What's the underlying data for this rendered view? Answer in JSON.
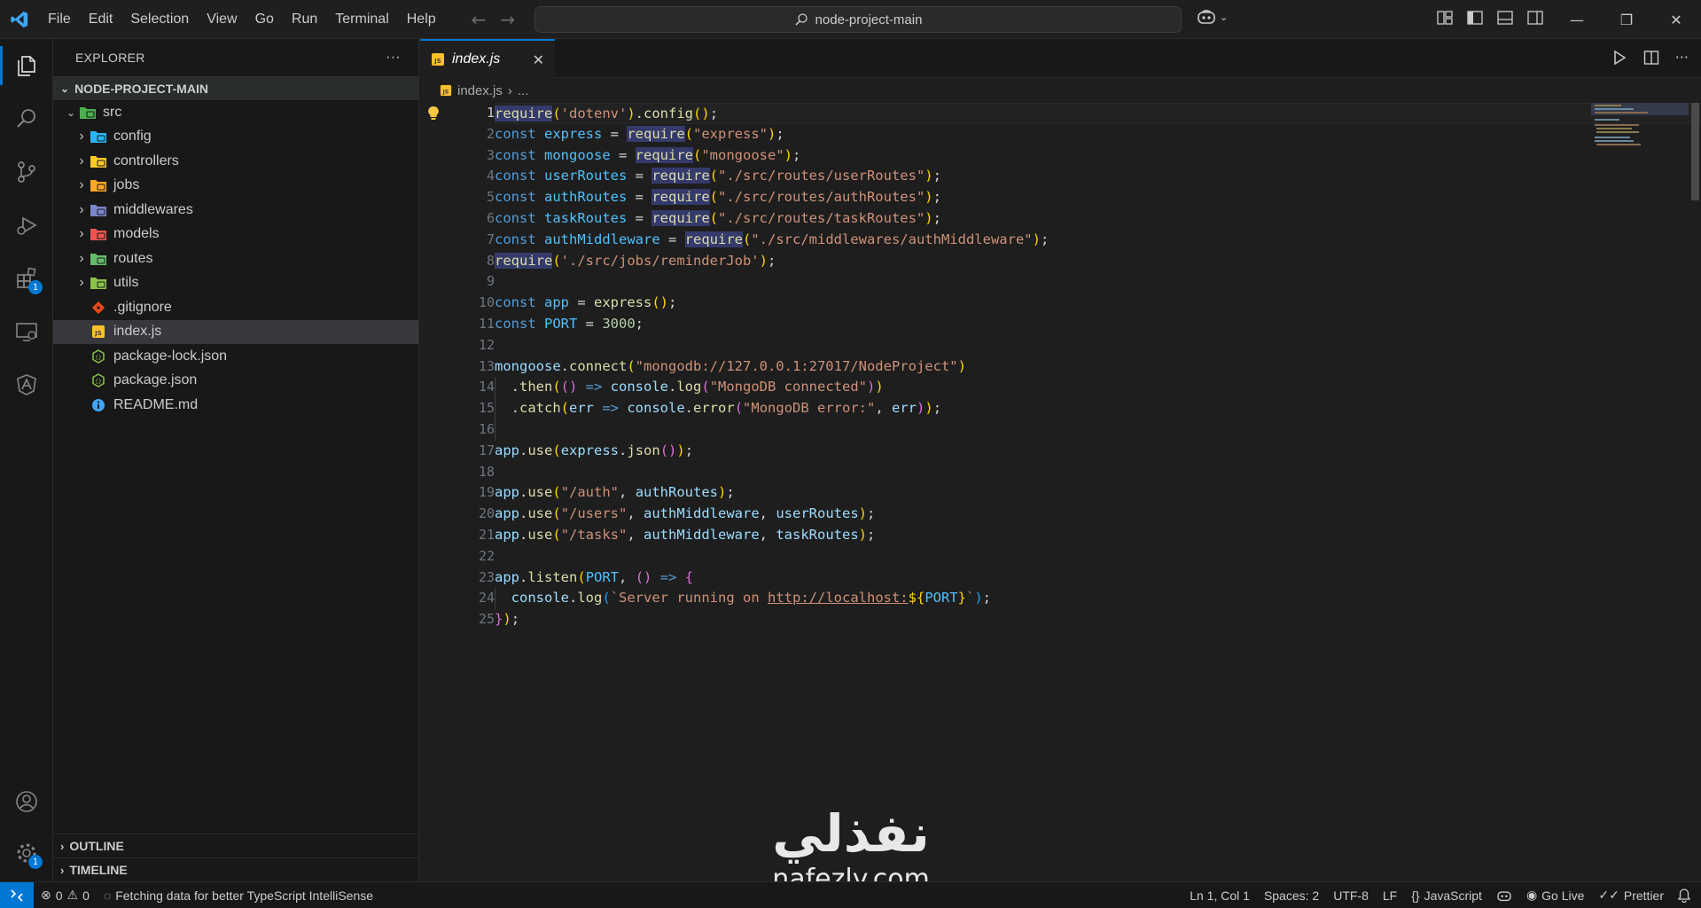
{
  "menu": [
    "File",
    "Edit",
    "Selection",
    "View",
    "Go",
    "Run",
    "Terminal",
    "Help"
  ],
  "command_center": "node-project-main",
  "explorer": {
    "title": "EXPLORER",
    "more": "···",
    "root": "NODE-PROJECT-MAIN",
    "items": [
      {
        "label": "src",
        "level": 1,
        "chevron": "⌄",
        "icon": "folder-src-icon",
        "color": "#4caf50"
      },
      {
        "label": "config",
        "level": 2,
        "chevron": "›",
        "icon": "folder-config-icon",
        "color": "#29b6f6"
      },
      {
        "label": "controllers",
        "level": 2,
        "chevron": "›",
        "icon": "folder-controllers-icon",
        "color": "#ffca28"
      },
      {
        "label": "jobs",
        "level": 2,
        "chevron": "›",
        "icon": "folder-jobs-icon",
        "color": "#ffa726"
      },
      {
        "label": "middlewares",
        "level": 2,
        "chevron": "›",
        "icon": "folder-middlewares-icon",
        "color": "#7986cb"
      },
      {
        "label": "models",
        "level": 2,
        "chevron": "›",
        "icon": "folder-models-icon",
        "color": "#ef5350"
      },
      {
        "label": "routes",
        "level": 2,
        "chevron": "›",
        "icon": "folder-routes-icon",
        "color": "#66bb6a"
      },
      {
        "label": "utils",
        "level": 2,
        "chevron": "›",
        "icon": "folder-utils-icon",
        "color": "#8bc34a"
      },
      {
        "label": ".gitignore",
        "level": 2,
        "chevron": "",
        "icon": "git-icon",
        "color": "#e64a19"
      },
      {
        "label": "index.js",
        "level": 2,
        "chevron": "",
        "icon": "js-file-icon",
        "color": "#fbc02d"
      },
      {
        "label": "package-lock.json",
        "level": 2,
        "chevron": "",
        "icon": "nodejs-icon",
        "color": "#8bc34a"
      },
      {
        "label": "package.json",
        "level": 2,
        "chevron": "",
        "icon": "nodejs-icon",
        "color": "#8bc34a"
      },
      {
        "label": "README.md",
        "level": 2,
        "chevron": "",
        "icon": "info-icon",
        "color": "#42a5f5"
      }
    ],
    "selected": "index.js",
    "outline": "OUTLINE",
    "timeline": "TIMELINE"
  },
  "activity": {
    "extensions_badge": "1",
    "settings_badge": "1"
  },
  "tab": {
    "label": "index.js",
    "close": "✕"
  },
  "breadcrumb": {
    "file": "index.js",
    "sep": "›",
    "rest": "..."
  },
  "code_lines": [
    [
      [
        "hl t-fn",
        "require"
      ],
      [
        "t-p1",
        "("
      ],
      [
        "t-str",
        "'dotenv'"
      ],
      [
        "t-p1",
        ")"
      ],
      [
        "t-pl",
        "."
      ],
      [
        "t-fn",
        "config"
      ],
      [
        "t-p1",
        "()"
      ],
      [
        "t-pl",
        ";"
      ]
    ],
    [
      [
        "t-kw",
        "const "
      ],
      [
        "t-const",
        "express"
      ],
      [
        "t-pl",
        " = "
      ],
      [
        "hl t-fn",
        "require"
      ],
      [
        "t-p1",
        "("
      ],
      [
        "t-str",
        "\"express\""
      ],
      [
        "t-p1",
        ")"
      ],
      [
        "t-pl",
        ";"
      ]
    ],
    [
      [
        "t-kw",
        "const "
      ],
      [
        "t-const",
        "mongoose"
      ],
      [
        "t-pl",
        " = "
      ],
      [
        "hl t-fn",
        "require"
      ],
      [
        "t-p1",
        "("
      ],
      [
        "t-str",
        "\"mongoose\""
      ],
      [
        "t-p1",
        ")"
      ],
      [
        "t-pl",
        ";"
      ]
    ],
    [
      [
        "t-kw",
        "const "
      ],
      [
        "t-const",
        "userRoutes"
      ],
      [
        "t-pl",
        " = "
      ],
      [
        "hl t-fn",
        "require"
      ],
      [
        "t-p1",
        "("
      ],
      [
        "t-str",
        "\"./src/routes/userRoutes\""
      ],
      [
        "t-p1",
        ")"
      ],
      [
        "t-pl",
        ";"
      ]
    ],
    [
      [
        "t-kw",
        "const "
      ],
      [
        "t-const",
        "authRoutes"
      ],
      [
        "t-pl",
        " = "
      ],
      [
        "hl t-fn",
        "require"
      ],
      [
        "t-p1",
        "("
      ],
      [
        "t-str",
        "\"./src/routes/authRoutes\""
      ],
      [
        "t-p1",
        ")"
      ],
      [
        "t-pl",
        ";"
      ]
    ],
    [
      [
        "t-kw",
        "const "
      ],
      [
        "t-const",
        "taskRoutes"
      ],
      [
        "t-pl",
        " = "
      ],
      [
        "hl t-fn",
        "require"
      ],
      [
        "t-p1",
        "("
      ],
      [
        "t-str",
        "\"./src/routes/taskRoutes\""
      ],
      [
        "t-p1",
        ")"
      ],
      [
        "t-pl",
        ";"
      ]
    ],
    [
      [
        "t-kw",
        "const "
      ],
      [
        "t-const",
        "authMiddleware"
      ],
      [
        "t-pl",
        " = "
      ],
      [
        "hl t-fn",
        "require"
      ],
      [
        "t-p1",
        "("
      ],
      [
        "t-str",
        "\"./src/middlewares/authMiddleware\""
      ],
      [
        "t-p1",
        ")"
      ],
      [
        "t-pl",
        ";"
      ]
    ],
    [
      [
        "hl t-fn",
        "require"
      ],
      [
        "t-p1",
        "("
      ],
      [
        "t-str",
        "'./src/jobs/reminderJob'"
      ],
      [
        "t-p1",
        ")"
      ],
      [
        "t-pl",
        ";"
      ]
    ],
    [],
    [
      [
        "t-kw",
        "const "
      ],
      [
        "t-const",
        "app"
      ],
      [
        "t-pl",
        " = "
      ],
      [
        "t-fn",
        "express"
      ],
      [
        "t-p1",
        "()"
      ],
      [
        "t-pl",
        ";"
      ]
    ],
    [
      [
        "t-kw",
        "const "
      ],
      [
        "t-const",
        "PORT"
      ],
      [
        "t-pl",
        " = "
      ],
      [
        "t-num",
        "3000"
      ],
      [
        "t-pl",
        ";"
      ]
    ],
    [],
    [
      [
        "t-var",
        "mongoose"
      ],
      [
        "t-pl",
        "."
      ],
      [
        "t-fn",
        "connect"
      ],
      [
        "t-p1",
        "("
      ],
      [
        "t-str",
        "\"mongodb://127.0.0.1:27017/NodeProject\""
      ],
      [
        "t-p1",
        ")"
      ]
    ],
    [
      [
        "t-pl",
        "  ."
      ],
      [
        "t-fn",
        "then"
      ],
      [
        "t-p1",
        "("
      ],
      [
        "t-p2",
        "()"
      ],
      [
        "t-kw",
        " => "
      ],
      [
        "t-var",
        "console"
      ],
      [
        "t-pl",
        "."
      ],
      [
        "t-fn",
        "log"
      ],
      [
        "t-p2",
        "("
      ],
      [
        "t-str",
        "\"MongoDB connected\""
      ],
      [
        "t-p2",
        ")"
      ],
      [
        "t-p1",
        ")"
      ]
    ],
    [
      [
        "t-pl",
        "  ."
      ],
      [
        "t-fn",
        "catch"
      ],
      [
        "t-p1",
        "("
      ],
      [
        "t-var",
        "err"
      ],
      [
        "t-kw",
        " => "
      ],
      [
        "t-var",
        "console"
      ],
      [
        "t-pl",
        "."
      ],
      [
        "t-fn",
        "error"
      ],
      [
        "t-p2",
        "("
      ],
      [
        "t-str",
        "\"MongoDB error:\""
      ],
      [
        "t-pl",
        ", "
      ],
      [
        "t-var",
        "err"
      ],
      [
        "t-p2",
        ")"
      ],
      [
        "t-p1",
        ")"
      ],
      [
        "t-pl",
        ";"
      ]
    ],
    [],
    [
      [
        "t-var",
        "app"
      ],
      [
        "t-pl",
        "."
      ],
      [
        "t-fn",
        "use"
      ],
      [
        "t-p1",
        "("
      ],
      [
        "t-var",
        "express"
      ],
      [
        "t-pl",
        "."
      ],
      [
        "t-fn",
        "json"
      ],
      [
        "t-p2",
        "()"
      ],
      [
        "t-p1",
        ")"
      ],
      [
        "t-pl",
        ";"
      ]
    ],
    [],
    [
      [
        "t-var",
        "app"
      ],
      [
        "t-pl",
        "."
      ],
      [
        "t-fn",
        "use"
      ],
      [
        "t-p1",
        "("
      ],
      [
        "t-str",
        "\"/auth\""
      ],
      [
        "t-pl",
        ", "
      ],
      [
        "t-var",
        "authRoutes"
      ],
      [
        "t-p1",
        ")"
      ],
      [
        "t-pl",
        ";"
      ]
    ],
    [
      [
        "t-var",
        "app"
      ],
      [
        "t-pl",
        "."
      ],
      [
        "t-fn",
        "use"
      ],
      [
        "t-p1",
        "("
      ],
      [
        "t-str",
        "\"/users\""
      ],
      [
        "t-pl",
        ", "
      ],
      [
        "t-var",
        "authMiddleware"
      ],
      [
        "t-pl",
        ", "
      ],
      [
        "t-var",
        "userRoutes"
      ],
      [
        "t-p1",
        ")"
      ],
      [
        "t-pl",
        ";"
      ]
    ],
    [
      [
        "t-var",
        "app"
      ],
      [
        "t-pl",
        "."
      ],
      [
        "t-fn",
        "use"
      ],
      [
        "t-p1",
        "("
      ],
      [
        "t-str",
        "\"/tasks\""
      ],
      [
        "t-pl",
        ", "
      ],
      [
        "t-var",
        "authMiddleware"
      ],
      [
        "t-pl",
        ", "
      ],
      [
        "t-var",
        "taskRoutes"
      ],
      [
        "t-p1",
        ")"
      ],
      [
        "t-pl",
        ";"
      ]
    ],
    [],
    [
      [
        "t-var",
        "app"
      ],
      [
        "t-pl",
        "."
      ],
      [
        "t-fn",
        "listen"
      ],
      [
        "t-p1",
        "("
      ],
      [
        "t-const",
        "PORT"
      ],
      [
        "t-pl",
        ", "
      ],
      [
        "t-p2",
        "()"
      ],
      [
        "t-kw",
        " => "
      ],
      [
        "t-p2",
        "{"
      ]
    ],
    [
      [
        "t-pl",
        "  "
      ],
      [
        "t-var",
        "console"
      ],
      [
        "t-pl",
        "."
      ],
      [
        "t-fn",
        "log"
      ],
      [
        "t-p3",
        "("
      ],
      [
        "t-str",
        "`Server running on "
      ],
      [
        "t-str url",
        "http://localhost:"
      ],
      [
        "t-p1",
        "${"
      ],
      [
        "t-const",
        "PORT"
      ],
      [
        "t-p1",
        "}"
      ],
      [
        "t-str",
        "`"
      ],
      [
        "t-p3",
        ")"
      ],
      [
        "t-pl",
        ";"
      ]
    ],
    [
      [
        "t-p2",
        "}"
      ],
      [
        "t-p1",
        ")"
      ],
      [
        "t-pl",
        ";"
      ]
    ]
  ],
  "watermark": {
    "arabic": "نفذلي",
    "latin": "nafezly.com"
  },
  "status": {
    "errors": "0",
    "warnings": "0",
    "message": "Fetching data for better TypeScript IntelliSense",
    "position": "Ln 1, Col 1",
    "spaces": "Spaces: 2",
    "encoding": "UTF-8",
    "eol": "LF",
    "language": "JavaScript",
    "golive": "Go Live",
    "prettier": "Prettier"
  }
}
